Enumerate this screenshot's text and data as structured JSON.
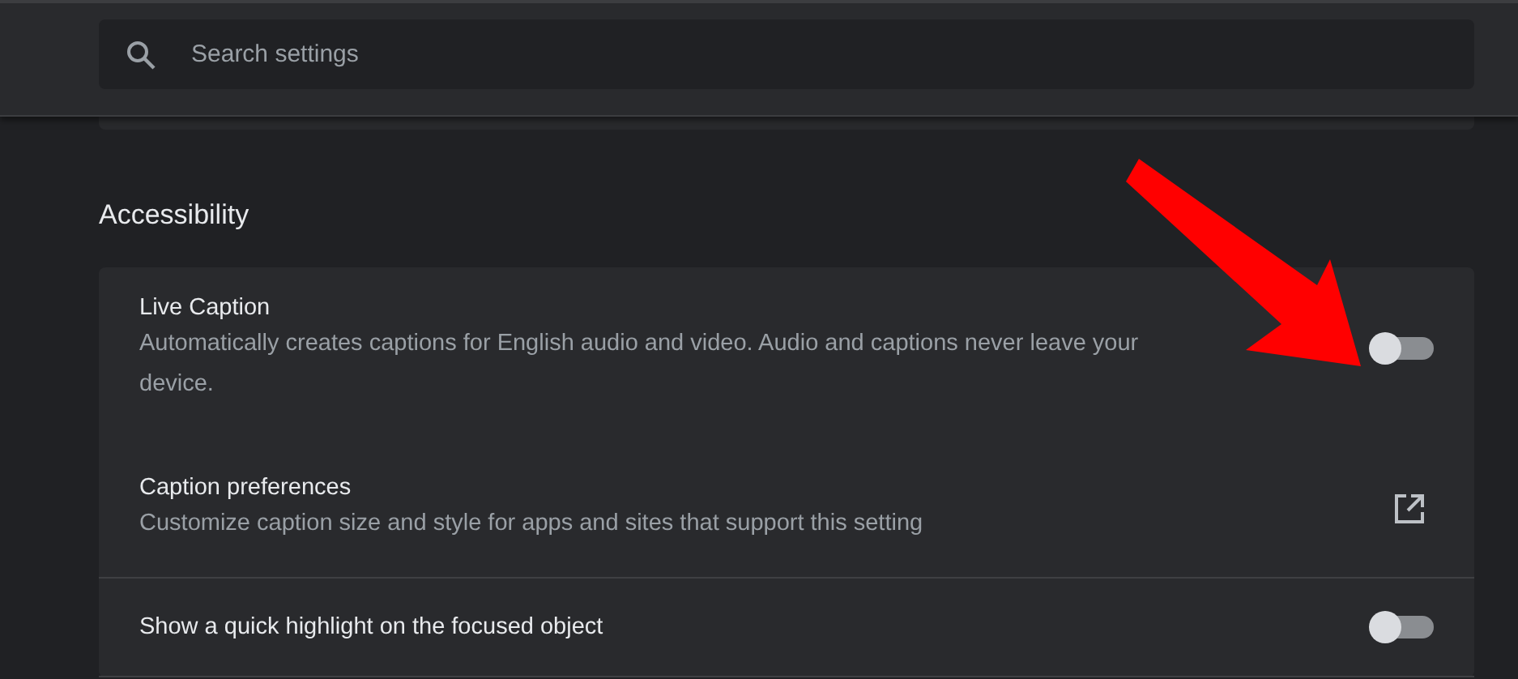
{
  "search": {
    "placeholder": "Search settings"
  },
  "section": {
    "title": "Accessibility"
  },
  "rows": [
    {
      "kind": "toggle",
      "title": "Live Caption",
      "description": "Automatically creates captions for English audio and video. Audio and captions never leave your device.",
      "on": false
    },
    {
      "kind": "link",
      "title": "Caption preferences",
      "description": "Customize caption size and style for apps and sites that support this setting"
    },
    {
      "kind": "toggle",
      "title": "Show a quick highlight on the focused object",
      "on": false
    }
  ]
}
